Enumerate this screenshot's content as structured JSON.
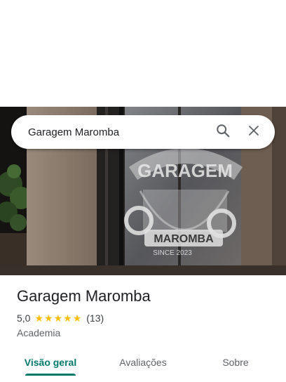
{
  "search": {
    "value": "Garagem Maromba",
    "search_icon": "search-icon",
    "close_icon": "close-icon"
  },
  "hero": {
    "sign_top": "GARAGEM",
    "sign_bottom": "MAROMBA",
    "sign_since": "SINCE 2023"
  },
  "place": {
    "title": "Garagem Maromba",
    "rating": "5,0",
    "stars": 5,
    "review_count": "(13)",
    "category": "Academia"
  },
  "tabs": [
    {
      "label": "Visão geral",
      "active": true
    },
    {
      "label": "Avaliações",
      "active": false
    },
    {
      "label": "Sobre",
      "active": false
    }
  ],
  "colors": {
    "accent": "#00796b",
    "star": "#fbbc04"
  }
}
